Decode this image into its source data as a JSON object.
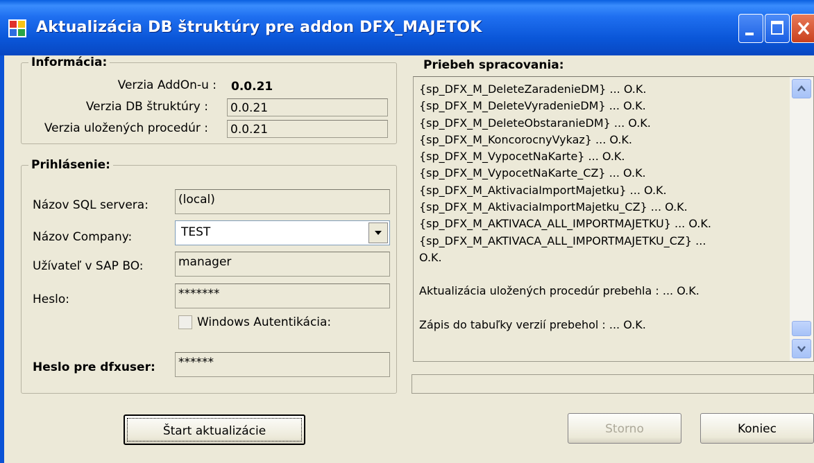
{
  "window": {
    "title": "Aktualizácia DB štruktúry pre addon DFX_MAJETOK"
  },
  "info": {
    "legend": "Informácia:",
    "rows": [
      {
        "label": "Verzia AddOn-u :",
        "value": "0.0.21"
      },
      {
        "label": "Verzia DB štruktúry :",
        "value": "0.0.21"
      },
      {
        "label": "Verzia uložených procedúr :",
        "value": "0.0.21"
      }
    ]
  },
  "login": {
    "legend": "Prihlásenie:",
    "sql_server_label": "Názov SQL servera:",
    "sql_server_value": "(local)",
    "company_label": "Názov Company:",
    "company_value": "TEST",
    "user_label": "Užívateľ v SAP BO:",
    "user_value": "manager",
    "password_label": "Heslo:",
    "password_value": "*******",
    "windows_auth_label": "Windows Autentikácia:",
    "dfx_password_label": "Heslo pre dfxuser:",
    "dfx_password_value": "******"
  },
  "progress": {
    "heading": "Priebeh spracovania:",
    "lines": [
      "{sp_DFX_M_DeleteZaradenieDM} ... O.K.",
      "{sp_DFX_M_DeleteVyradenieDM} ... O.K.",
      "{sp_DFX_M_DeleteObstaranieDM} ... O.K.",
      "{sp_DFX_M_KoncorocnyVykaz} ... O.K.",
      "{sp_DFX_M_VypocetNaKarte} ... O.K.",
      "{sp_DFX_M_VypocetNaKarte_CZ} ... O.K.",
      "{sp_DFX_M_AktivaciaImportMajetku} ... O.K.",
      "{sp_DFX_M_AktivaciaImportMajetku_CZ} ... O.K.",
      "{sp_DFX_M_AKTIVACA_ALL_IMPORTMAJETKU} ... O.K.",
      "{sp_DFX_M_AKTIVACA_ALL_IMPORTMAJETKU_CZ} ...",
      "O.K.",
      "",
      "Aktualizácia uložených procedúr prebehla : ... O.K.",
      "",
      "Zápis do tabuľky verzií prebehol : ... O.K."
    ]
  },
  "buttons": {
    "start": "Štart aktualizácie",
    "cancel": "Storno",
    "close": "Koniec"
  },
  "icons": {
    "app": "app-window-icon",
    "minimize": "minimize-icon",
    "maximize": "maximize-icon",
    "close": "close-icon",
    "dropdown": "chevron-down-icon",
    "scroll_up": "scroll-up-icon",
    "scroll_down": "scroll-down-icon"
  }
}
